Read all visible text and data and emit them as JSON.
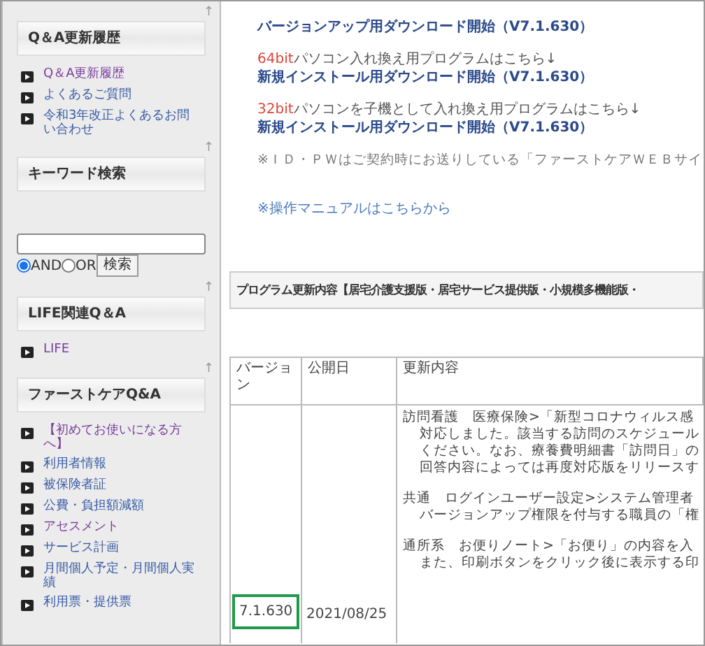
{
  "sidebar": {
    "sections": [
      {
        "title": "Q＆A更新履歴",
        "kind": "links",
        "items": [
          {
            "label": "Q＆A更新履歴",
            "visited": true
          },
          {
            "label": "よくあるご質問",
            "visited": false
          },
          {
            "label": "令和3年改正よくあるお問い合わせ",
            "visited": false
          }
        ]
      },
      {
        "title": "キーワード検索",
        "kind": "search",
        "options": [
          {
            "label": "AND",
            "selected": true
          },
          {
            "label": "OR",
            "selected": false
          }
        ],
        "button": "検索"
      },
      {
        "title": "LIFE関連Q＆A",
        "kind": "links",
        "items": [
          {
            "label": "LIFE",
            "visited": true
          }
        ]
      },
      {
        "title": "ファーストケアQ&A",
        "kind": "links",
        "items": [
          {
            "label": "【初めてお使いになる方へ】",
            "visited": true
          },
          {
            "label": "利用者情報",
            "visited": false
          },
          {
            "label": "被保険者証",
            "visited": false
          },
          {
            "label": "公費・負担額減額",
            "visited": false
          },
          {
            "label": "アセスメント",
            "visited": true
          },
          {
            "label": "サービス計画",
            "visited": false
          },
          {
            "label": "月間個人予定・月間個人実績",
            "visited": false
          },
          {
            "label": "利用票・提供票",
            "visited": false
          }
        ]
      }
    ],
    "top_link": "↑"
  },
  "downloads": [
    {
      "link": "バージョンアップ用ダウンロード開始（V7.1.630）"
    },
    {
      "note_prefix": "64bit",
      "note": "パソコン入れ換え用プログラムはこちら↓",
      "link": "新規インストール用ダウンロード開始（V7.1.630）"
    },
    {
      "note_prefix": "32bit",
      "note": "パソコンを子機として入れ換え用プログラムはこちら↓",
      "link": "新規インストール用ダウンロード開始（V7.1.630）"
    }
  ],
  "id_note": "※ＩＤ・ＰＷはご契約時にお送りしている「ファーストケアＷＥＢサイ",
  "manual_link": "※操作マニュアルはこちらから",
  "update_heading": "プログラム更新内容【居宅介護支援版・居宅サービス提供版・小規模多機能版・",
  "table": {
    "columns": [
      "バージョン",
      "公開日",
      "更新内容"
    ],
    "rows": [
      {
        "version": "7.1.630",
        "highlighted": true,
        "date": "2021/08/25",
        "content": [
          {
            "lines": [
              "訪問看護　医療保険>「新型コロナウィルス感",
              "対応しました。該当する訪問のスケジュール",
              "ください。なお、療養費明細書「訪問日」の",
              "回答内容によっては再度対応版をリリースす"
            ]
          },
          {
            "lines": [
              "共通　ログインユーザー設定>システム管理者",
              "バージョンアップ権限を付与する職員の「権"
            ]
          },
          {
            "lines": [
              "通所系　お便りノート>「お便り」の内容を入",
              "また、印刷ボタンをクリック後に表示する印"
            ]
          }
        ]
      }
    ]
  }
}
